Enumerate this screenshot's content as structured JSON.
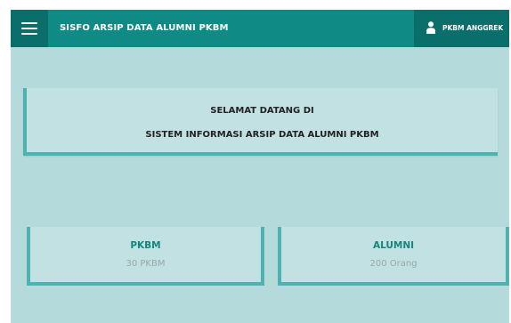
{
  "header": {
    "title": "SISFO ARSIP DATA ALUMNI PKBM",
    "menu_icon": "hamburger-menu-icon",
    "user": {
      "label": "PKBM ANGGREK",
      "icon": "user-icon"
    }
  },
  "welcome": {
    "line1": "SELAMAT DATANG DI",
    "line2": "SISTEM INFORMASI ARSIP DATA ALUMNI PKBM"
  },
  "stats": [
    {
      "title": "PKBM",
      "value": "30 PKBM"
    },
    {
      "title": "ALUMNI",
      "value": "200 Orang"
    }
  ],
  "colors": {
    "header": "#0f8a84",
    "header_dark": "#0a6f6a",
    "background": "#b4dadb",
    "card": "#c2e1e3",
    "card_border": "#4eb3b0",
    "accent_text": "#16857f"
  }
}
